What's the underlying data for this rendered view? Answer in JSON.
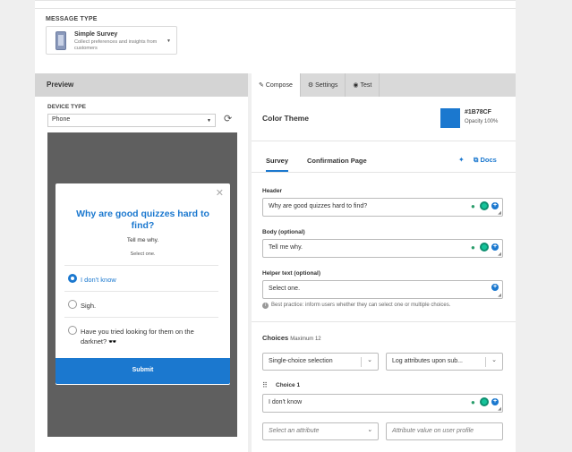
{
  "message_type": {
    "label": "MESSAGE TYPE",
    "selected_title": "Simple Survey",
    "selected_desc": "Collect preferences and insights from customers"
  },
  "preview": {
    "heading": "Preview",
    "device_label": "DEVICE TYPE",
    "device_value": "Phone",
    "modal": {
      "question": "Why are good quizzes hard to find?",
      "body": "Tell me why.",
      "helper": "Select one.",
      "options": [
        {
          "label": "I don't know",
          "selected": true
        },
        {
          "label": "Sigh.",
          "selected": false
        },
        {
          "label": "Have you tried looking for them on the darknet? 🕶️",
          "selected": false
        }
      ],
      "submit": "Submit"
    }
  },
  "tabs": [
    {
      "label": "Compose",
      "icon": "pencil-icon",
      "active": true
    },
    {
      "label": "Settings",
      "icon": "gear-icon",
      "active": false
    },
    {
      "label": "Test",
      "icon": "eye-icon",
      "active": false
    }
  ],
  "color_theme": {
    "label": "Color Theme",
    "hex": "#1B78CF",
    "opacity": "Opacity 100%",
    "color": "#1b78cf"
  },
  "subtabs": {
    "survey": "Survey",
    "confirmation": "Confirmation Page",
    "docs": "Docs"
  },
  "form": {
    "header_label": "Header",
    "header_value": "Why are good quizzes hard to find?",
    "body_label": "Body (optional)",
    "body_value": "Tell me why.",
    "helper_label": "Helper text (optional)",
    "helper_value": "Select one.",
    "hint": "Best practice: inform users whether they can select one or multiple choices."
  },
  "choices": {
    "label": "Choices",
    "max": "Maximum 12",
    "mode": "Single-choice selection",
    "log": "Log attributes upon sub...",
    "choice1_label": "Choice 1",
    "choice1_value": "I don't know",
    "attr_placeholder": "Select an attribute",
    "attr_value_placeholder": "Attribute value on user profile"
  }
}
